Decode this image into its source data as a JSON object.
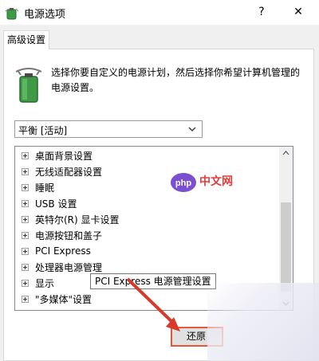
{
  "window": {
    "title": "电源选项",
    "help_glyph": "?",
    "close_glyph": "✕"
  },
  "tabs": [
    {
      "label": "高级设置",
      "active": true
    }
  ],
  "description": "选择你要自定义的电源计划，然后选择你希望计算机管理的电源设置。",
  "plan_select": {
    "value": "平衡 [活动]"
  },
  "settings_tree": {
    "items": [
      {
        "label": "桌面背景设置"
      },
      {
        "label": "无线适配器设置"
      },
      {
        "label": "睡眠"
      },
      {
        "label": "USB 设置"
      },
      {
        "label": "英特尔(R) 显卡设置"
      },
      {
        "label": "电源按钮和盖子"
      },
      {
        "label": "PCI Express"
      },
      {
        "label": "处理器电源管理"
      },
      {
        "label": "显示"
      },
      {
        "label": "\"多媒体\"设置"
      }
    ]
  },
  "tooltip": "PCI Express 电源管理设置",
  "restore_button": "还原",
  "watermark": {
    "text": "中文网",
    "logo_text": "php"
  },
  "colors": {
    "accent_red": "#e25a3c",
    "watermark_red": "#e53b3b",
    "watermark_purple": "#7a4fd1",
    "battery_green": "#3f9a45"
  },
  "icons": [
    "power-options-icon",
    "battery-plan-icon",
    "chevron-down-icon",
    "expand-icon",
    "scroll-up-icon",
    "scroll-down-icon"
  ]
}
